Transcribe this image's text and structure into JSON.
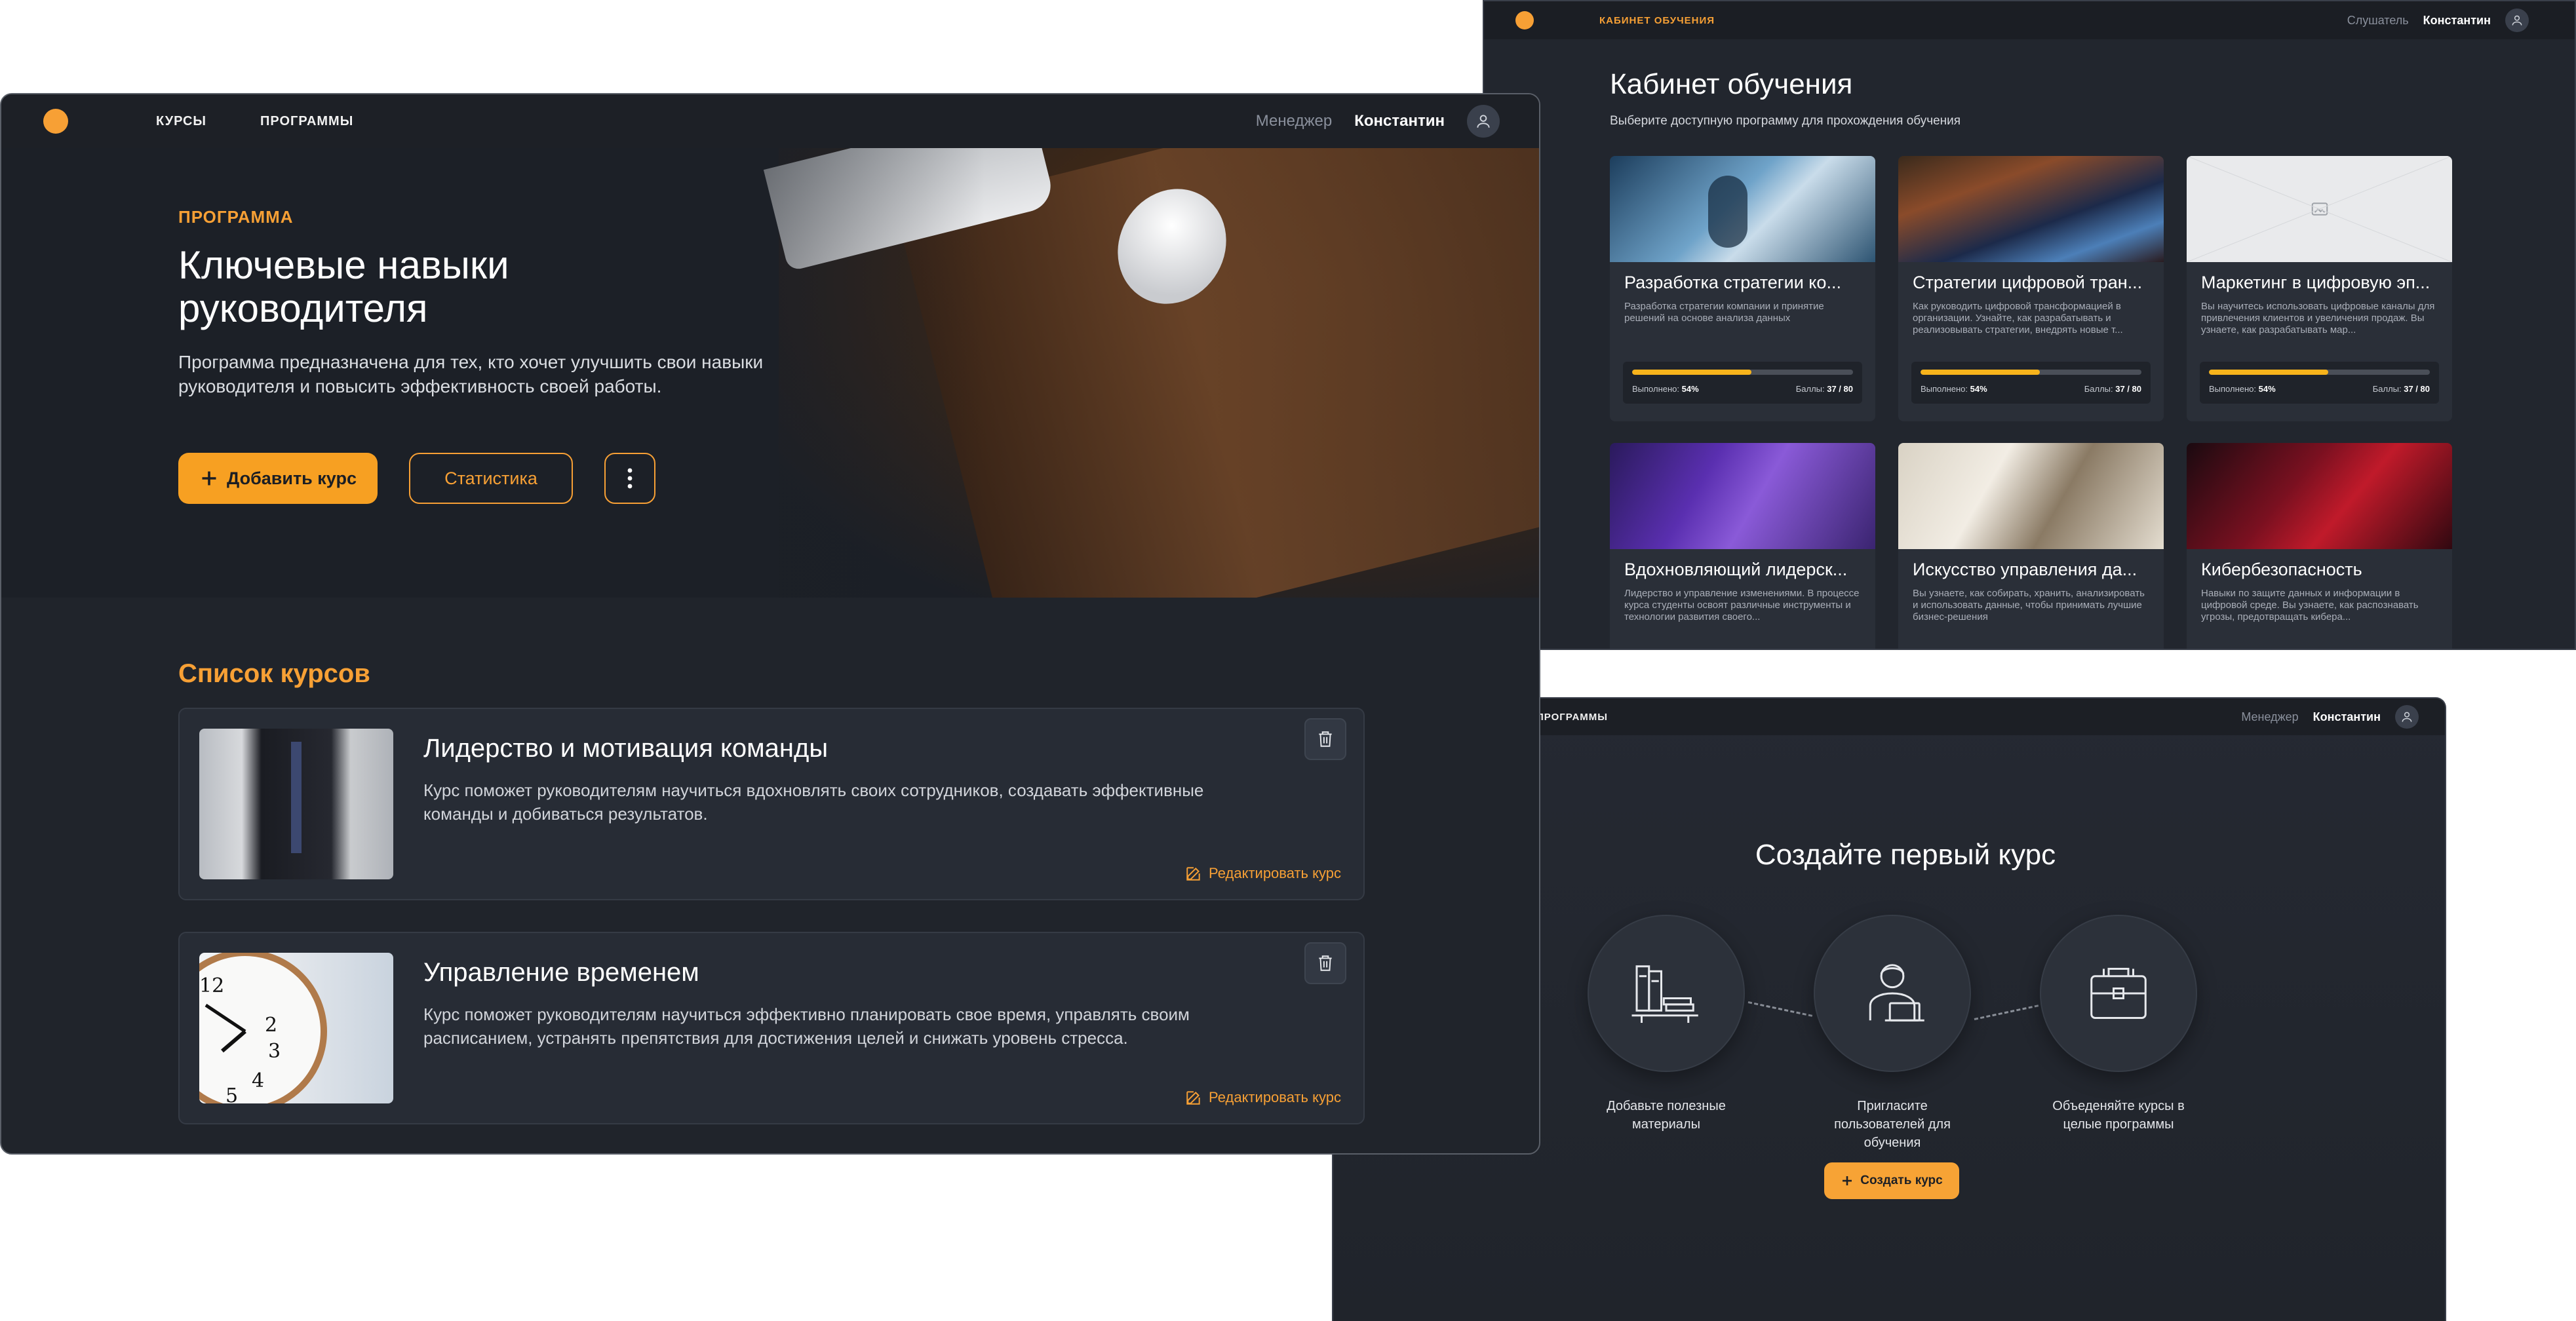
{
  "colors": {
    "accent": "#f7a035",
    "bg_dark": "#20242b",
    "progress": "#f7b31b"
  },
  "cabinet": {
    "brand": "Кабинет обучения",
    "role": "Слушатель",
    "user": "Константин",
    "title": "Кабинет обучения",
    "subtitle": "Выберите доступную программу для прохождения обучения",
    "progress_label": "Выполнено:",
    "score_label": "Баллы:",
    "cards": [
      {
        "title": "Разработка стратегии ко...",
        "desc": "Разработка стратегии компании и принятие решений на основе анализа данных",
        "progress": 0.54,
        "progress_text": "54%",
        "score": "37 / 80",
        "image": "tech-glass"
      },
      {
        "title": "Стратегии цифровой тран...",
        "desc": "Как руководить цифровой трансформацией в организации. Узнайте, как разрабатывать и реализовывать стратегии, внедрять новые т...",
        "progress": 0.54,
        "progress_text": "54%",
        "score": "37 / 80",
        "image": "code-lights"
      },
      {
        "title": "Маркетинг в цифровую эп...",
        "desc": "Вы научитесь использовать цифровые каналы для привлечения клиентов и увеличения продаж. Вы узнаете, как разрабатывать мар...",
        "progress": 0.54,
        "progress_text": "54%",
        "score": "37 / 80",
        "image": "placeholder"
      },
      {
        "title": "Вдохновляющий лидерск...",
        "desc": "Лидерство и управление изменениями. В процессе курса студенты освоят различные инструменты и технологии развития своего...",
        "image": "people-purple"
      },
      {
        "title": "Искусство управления да...",
        "desc": "Вы узнаете, как собирать, хранить, анализировать и использовать данные, чтобы принимать лучшие бизнес-решения",
        "image": "people-office"
      },
      {
        "title": "Кибербезопасность",
        "desc": "Навыки по защите данных и информации в цифровой среде. Вы узнаете, как распознавать угрозы, предотвращать кибера...",
        "image": "red-stage"
      }
    ]
  },
  "create": {
    "nav_programs": "Программы",
    "role": "Менеджер",
    "user": "Константин",
    "title": "Создайте первый курс",
    "steps": [
      {
        "label": "Добавьте полезные материалы",
        "icon": "books-icon"
      },
      {
        "label": "Пригласите пользователей для обучения",
        "icon": "user-laptop-icon"
      },
      {
        "label": "Объеденяйте курсы в целые программы",
        "icon": "briefcase-icon"
      }
    ],
    "button": "Создать курс"
  },
  "program": {
    "nav": [
      "Курсы",
      "Программы"
    ],
    "role": "Менеджер",
    "user": "Константин",
    "eyebrow": "Программа",
    "title": "Ключевые навыки руководителя",
    "description": "Программа предназначена для тех, кто хочет улучшить свои навыки руководителя и повысить эффективность своей работы.",
    "add_course": "Добавить курс",
    "stats": "Статистика",
    "list_title": "Список курсов",
    "edit_label": "Редактировать курс",
    "courses": [
      {
        "title": "Лидерство и мотивация команды",
        "desc": "Курс поможет руководителям научиться вдохновлять своих сотрудников, создавать эффективные команды и добиваться результатов.",
        "image": "businessman"
      },
      {
        "title": "Управление временем",
        "desc": "Курс поможет руководителям научиться эффективно планировать свое время, управлять своим расписанием, устранять препятствия для достижения целей и снижать уровень стресса.",
        "image": "clock"
      }
    ]
  }
}
